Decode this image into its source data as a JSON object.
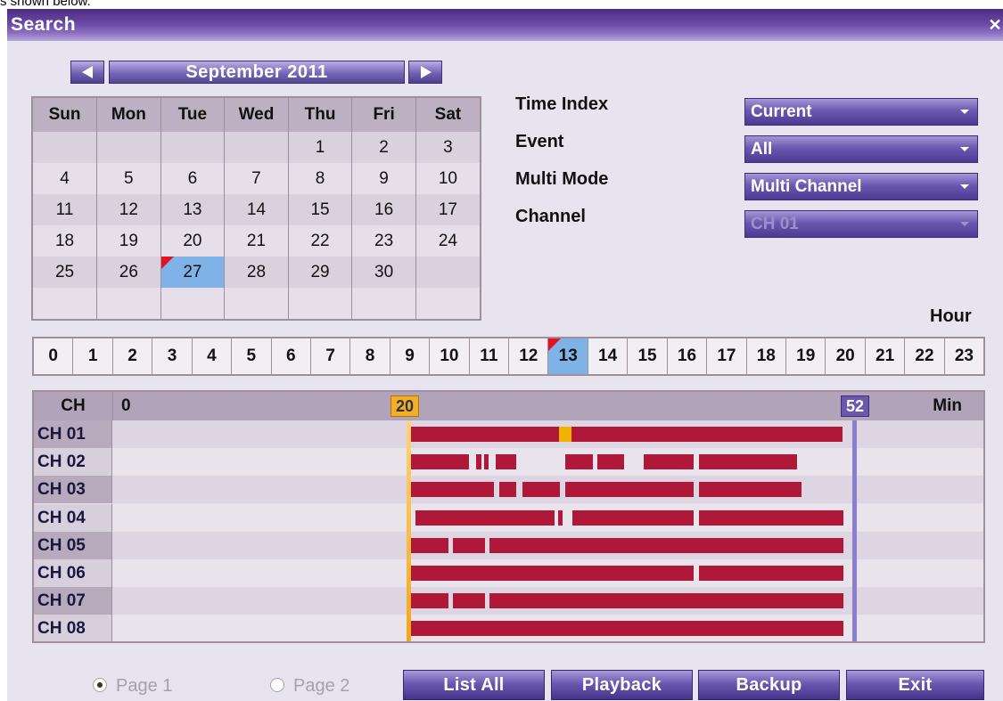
{
  "cut_text": "s shown below.",
  "window": {
    "title": "Search",
    "close": "✕"
  },
  "nav": {
    "month": "September 2011"
  },
  "calendar": {
    "weekdays": [
      "Sun",
      "Mon",
      "Tue",
      "Wed",
      "Thu",
      "Fri",
      "Sat"
    ],
    "weeks": [
      [
        "",
        "",
        "",
        "",
        "1",
        "2",
        "3"
      ],
      [
        "4",
        "5",
        "6",
        "7",
        "8",
        "9",
        "10"
      ],
      [
        "11",
        "12",
        "13",
        "14",
        "15",
        "16",
        "17"
      ],
      [
        "18",
        "19",
        "20",
        "21",
        "22",
        "23",
        "24"
      ],
      [
        "25",
        "26",
        "27",
        "28",
        "29",
        "30",
        ""
      ],
      [
        "",
        "",
        "",
        "",
        "",
        "",
        ""
      ]
    ],
    "selected_day": "27"
  },
  "options": [
    {
      "label": "Time Index",
      "value": "Current"
    },
    {
      "label": "Event",
      "value": "All"
    },
    {
      "label": "Multi Mode",
      "value": "Multi Channel"
    },
    {
      "label": "Channel",
      "value": "CH 01",
      "disabled": true
    }
  ],
  "hours": {
    "title": "Hour",
    "values": [
      "0",
      "1",
      "2",
      "3",
      "4",
      "5",
      "6",
      "7",
      "8",
      "9",
      "10",
      "11",
      "12",
      "13",
      "14",
      "15",
      "16",
      "17",
      "18",
      "19",
      "20",
      "21",
      "22",
      "23"
    ],
    "selected": "13"
  },
  "timeline": {
    "ch_header": "CH",
    "start_label": "0",
    "unit": "Min",
    "marker_start": "20",
    "marker_end": "52",
    "channels": [
      "CH 01",
      "CH 02",
      "CH 03",
      "CH 04",
      "CH 05",
      "CH 06",
      "CH 07",
      "CH 08"
    ]
  },
  "pages": [
    {
      "label": "Page 1",
      "selected": true
    },
    {
      "label": "Page 2",
      "selected": false
    }
  ],
  "buttons": {
    "list_all": "List All",
    "playback": "Playback",
    "backup": "Backup",
    "exit": "Exit"
  }
}
